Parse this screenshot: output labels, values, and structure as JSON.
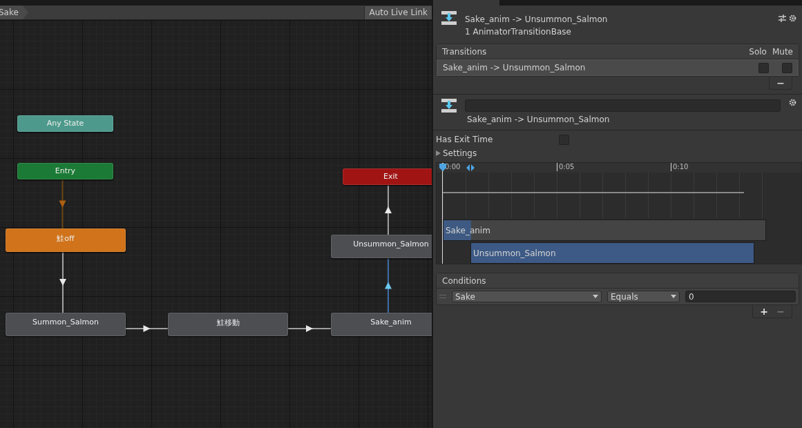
{
  "graph": {
    "breadcrumb": "Sake",
    "auto_live_link": "Auto Live Link",
    "nodes": [
      {
        "label": "Any State",
        "kind": "any"
      },
      {
        "label": "Entry",
        "kind": "entry"
      },
      {
        "label": "Exit",
        "kind": "exit"
      },
      {
        "label": "鮭off",
        "kind": "default"
      },
      {
        "label": "Unsummon_Salmon",
        "kind": "state"
      },
      {
        "label": "Summon_Salmon",
        "kind": "state"
      },
      {
        "label": "鮭移動",
        "kind": "state"
      },
      {
        "label": "Sake_anim",
        "kind": "state"
      }
    ],
    "transitions": [
      {
        "kind": "entry"
      },
      {
        "kind": "normal"
      },
      {
        "kind": "normal"
      },
      {
        "kind": "normal"
      },
      {
        "kind": "selected"
      },
      {
        "kind": "normal"
      }
    ]
  },
  "inspector": {
    "title": "Sake_anim -> Unsummon_Salmon",
    "subtitle": "1 AnimatorTransitionBase",
    "transitions_list": {
      "header": "Transitions",
      "columns": [
        "Solo",
        "Mute"
      ],
      "rows": [
        {
          "name": "Sake_anim -> Unsummon_Salmon",
          "selected": true,
          "solo": false,
          "mute": false
        }
      ],
      "buttons": [
        "−"
      ]
    },
    "transition": {
      "label": "Sake_anim -> Unsummon_Salmon",
      "has_exit_time": {
        "label": "Has Exit Time",
        "checked": false
      },
      "settings": {
        "label": "Settings",
        "expanded": false
      },
      "timeline": {
        "ticks": [
          "0:00",
          "0:05",
          "0:10"
        ],
        "tracks": [
          {
            "label": "Sake_anim"
          },
          {
            "label": "Unsummon_Salmon"
          }
        ]
      },
      "conditions": {
        "header": "Conditions",
        "rows": [
          {
            "parameter": "Sake",
            "mode": "Equals",
            "value": "0"
          }
        ],
        "buttons": [
          "+",
          "−"
        ]
      }
    }
  }
}
